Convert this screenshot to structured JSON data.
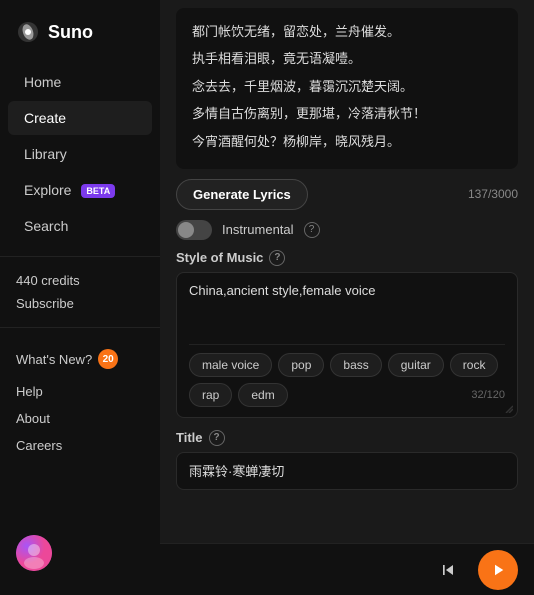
{
  "app": {
    "name": "Suno"
  },
  "sidebar": {
    "nav_items": [
      {
        "id": "home",
        "label": "Home",
        "active": false
      },
      {
        "id": "create",
        "label": "Create",
        "active": true
      },
      {
        "id": "library",
        "label": "Library",
        "active": false
      },
      {
        "id": "explore",
        "label": "Explore",
        "active": false,
        "badge": "BETA"
      },
      {
        "id": "search",
        "label": "Search",
        "active": false
      }
    ],
    "credits_label": "440 credits",
    "subscribe_label": "Subscribe",
    "whats_new_label": "What's New?",
    "notification_count": "20",
    "help_label": "Help",
    "about_label": "About",
    "careers_label": "Careers"
  },
  "lyrics": {
    "lines": [
      "都门帐饮无绪，留恋处，兰舟催发。",
      "执手相看泪眼，竟无语凝噎。",
      "念去去，千里烟波，暮霭沉沉楚天阔。",
      "多情自古伤离别，更那堪，冷落清秋节！",
      "今宵酒醒何处？杨柳岸，晓风残月。"
    ],
    "char_count": "137/3000",
    "generate_button": "Generate Lyrics"
  },
  "instrumental": {
    "label": "Instrumental",
    "enabled": false
  },
  "style_of_music": {
    "section_label": "Style of Music",
    "value": "China,ancient style,female voice",
    "tags": [
      {
        "id": "male-voice",
        "label": "male voice"
      },
      {
        "id": "pop",
        "label": "pop"
      },
      {
        "id": "bass",
        "label": "bass"
      },
      {
        "id": "guitar",
        "label": "guitar"
      },
      {
        "id": "rock",
        "label": "rock"
      },
      {
        "id": "rap",
        "label": "rap"
      },
      {
        "id": "edm",
        "label": "edm"
      }
    ],
    "char_count": "32/120"
  },
  "title": {
    "section_label": "Title",
    "value": "雨霖铃·寒蝉凄切"
  },
  "player": {
    "skip_back_icon": "⏮",
    "play_icon": "▶"
  }
}
